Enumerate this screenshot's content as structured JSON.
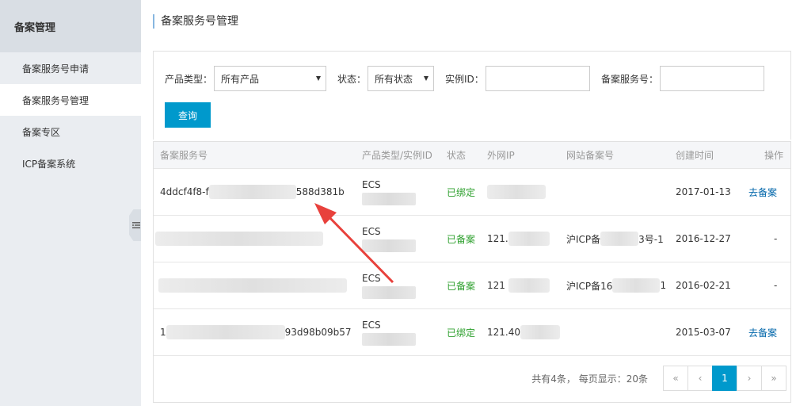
{
  "sidebar": {
    "title": "备案管理",
    "items": [
      {
        "label": "备案服务号申请"
      },
      {
        "label": "备案服务号管理"
      },
      {
        "label": "备案专区"
      },
      {
        "label": "ICP备案系统"
      }
    ]
  },
  "page": {
    "title": "备案服务号管理"
  },
  "filters": {
    "product_type_label": "产品类型：",
    "product_type_value": "所有产品",
    "status_label": "状态：",
    "status_value": "所有状态",
    "instance_label": "实例ID：",
    "service_no_label": "备案服务号：",
    "query_button": "查询"
  },
  "table": {
    "headers": [
      "备案服务号",
      "产品类型/实例ID",
      "状态",
      "外网IP",
      "网站备案号",
      "创建时间",
      "操作"
    ],
    "rows": [
      {
        "service_prefix": "4ddcf4f8-f",
        "service_suffix": "588d381b",
        "product": "ECS",
        "status": "已绑定",
        "ip": "",
        "icp_prefix": "",
        "icp_suffix": "",
        "created": "2017-01-13",
        "action": "去备案"
      },
      {
        "service_prefix": "",
        "service_suffix": "",
        "product": "ECS",
        "status": "已备案",
        "ip": "121.",
        "icp_prefix": "沪ICP备",
        "icp_suffix": "3号-1",
        "created": "2016-12-27",
        "action": "-"
      },
      {
        "service_prefix": "",
        "service_suffix": "",
        "product": "ECS",
        "status": "已备案",
        "ip": "121",
        "icp_prefix": "沪ICP备16",
        "icp_suffix": "1",
        "created": "2016-02-21",
        "action": "-"
      },
      {
        "service_prefix": "1",
        "service_suffix": "93d98b09b57",
        "product": "ECS",
        "status": "已绑定",
        "ip": "121.40",
        "icp_prefix": "",
        "icp_suffix": "",
        "created": "2015-03-07",
        "action": "去备案"
      }
    ]
  },
  "pagination": {
    "summary": "共有4条， 每页显示：20条",
    "first": "«",
    "prev": "‹",
    "current": "1",
    "next": "›",
    "last": "»"
  },
  "colors": {
    "accent": "#0099cc",
    "status_green": "#2ea02e",
    "link": "#0066aa",
    "arrow": "#e8413c"
  }
}
